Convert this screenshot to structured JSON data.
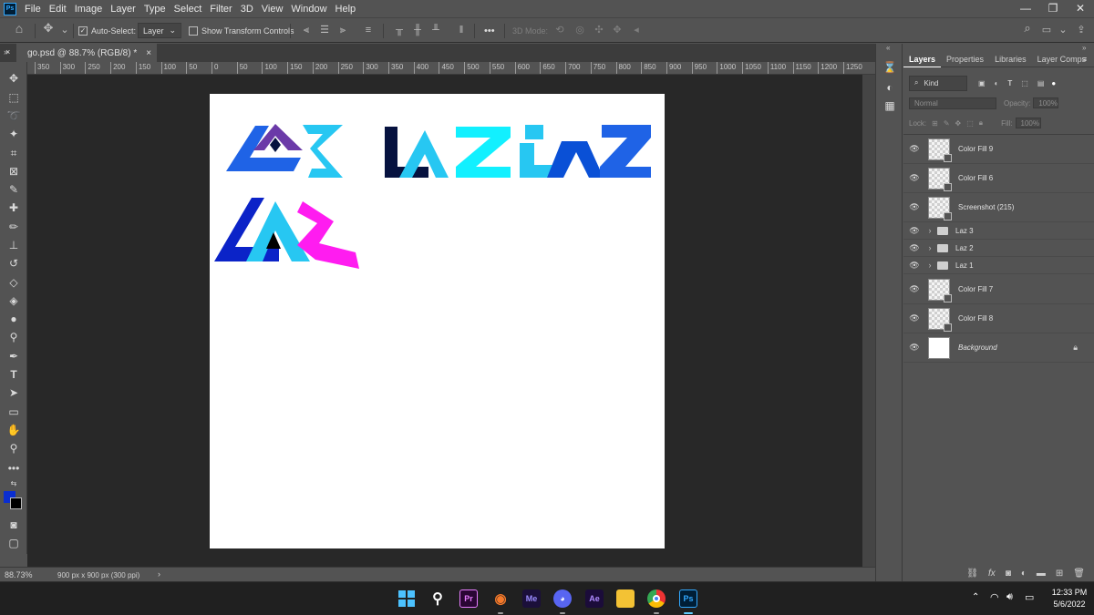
{
  "app": {
    "logo_label": "Ps",
    "menus": [
      "File",
      "Edit",
      "Image",
      "Layer",
      "Type",
      "Select",
      "Filter",
      "3D",
      "View",
      "Window",
      "Help"
    ]
  },
  "options_bar": {
    "auto_select_label": "Auto-Select:",
    "auto_select_checked": true,
    "auto_select_target": "Layer",
    "show_transform_controls_label": "Show Transform Controls",
    "show_transform_checked": false,
    "more_label": "•••",
    "mode_3d_label": "3D Mode:"
  },
  "document": {
    "tab_title": "go.psd @ 88.7% (RGB/8) *",
    "close_glyph": "×",
    "background_color": "#ffffff"
  },
  "ruler": {
    "labels": [
      "350",
      "300",
      "250",
      "200",
      "150",
      "100",
      "50",
      "0",
      "50",
      "100",
      "150",
      "200",
      "250",
      "300",
      "350",
      "400",
      "450",
      "500",
      "550",
      "600",
      "650",
      "700",
      "750",
      "800",
      "850",
      "900",
      "950",
      "1000",
      "1050",
      "1100",
      "1150",
      "1200",
      "1250"
    ]
  },
  "status_bar": {
    "zoom": "88.73%",
    "doc_info": "900 px x 900 px (300 ppi)",
    "arrow": "›"
  },
  "panel": {
    "tabs": [
      "Layers",
      "Properties",
      "Libraries",
      "Layer Comps"
    ],
    "active_tab": "Layers",
    "filter_kind": "Kind",
    "blend_mode": "Normal",
    "opacity_label": "Opacity:",
    "opacity_value": "100%",
    "lock_label": "Lock:",
    "fill_label": "Fill:",
    "fill_value": "100%",
    "layers": [
      {
        "name": "Color Fill 9",
        "type": "fill"
      },
      {
        "name": "Color Fill 6",
        "type": "fill"
      },
      {
        "name": "Screenshot (215)",
        "type": "fill"
      },
      {
        "name": "Laz 3",
        "type": "group"
      },
      {
        "name": "Laz 2",
        "type": "group"
      },
      {
        "name": "Laz 1",
        "type": "group"
      },
      {
        "name": "Color Fill 7",
        "type": "fill"
      },
      {
        "name": "Color Fill 8",
        "type": "fill"
      },
      {
        "name": "Background",
        "type": "background",
        "locked": true
      }
    ]
  },
  "colors": {
    "foreground": "#0a2ed1",
    "background": "#000000",
    "logo_blue": "#1f63e6",
    "logo_cyan": "#27c7f2",
    "logo_aqua": "#12f0ff",
    "logo_navy": "#06123f",
    "logo_royal": "#0a50d6",
    "logo_purple": "#6b3aa8",
    "logo_magenta": "#ff1cf0",
    "logo_dark_blue": "#0b23c8"
  },
  "taskbar": {
    "apps": [
      {
        "name": "windows-start",
        "label": ""
      },
      {
        "name": "search",
        "label": ""
      },
      {
        "name": "premiere",
        "label": "Pr"
      },
      {
        "name": "blender",
        "label": ""
      },
      {
        "name": "media-encoder",
        "label": "Me"
      },
      {
        "name": "discord",
        "label": ""
      },
      {
        "name": "after-effects",
        "label": "Ae"
      },
      {
        "name": "file-explorer",
        "label": ""
      },
      {
        "name": "chrome",
        "label": ""
      },
      {
        "name": "photoshop",
        "label": "Ps"
      }
    ],
    "time": "12:33 PM",
    "date": "5/6/2022"
  }
}
